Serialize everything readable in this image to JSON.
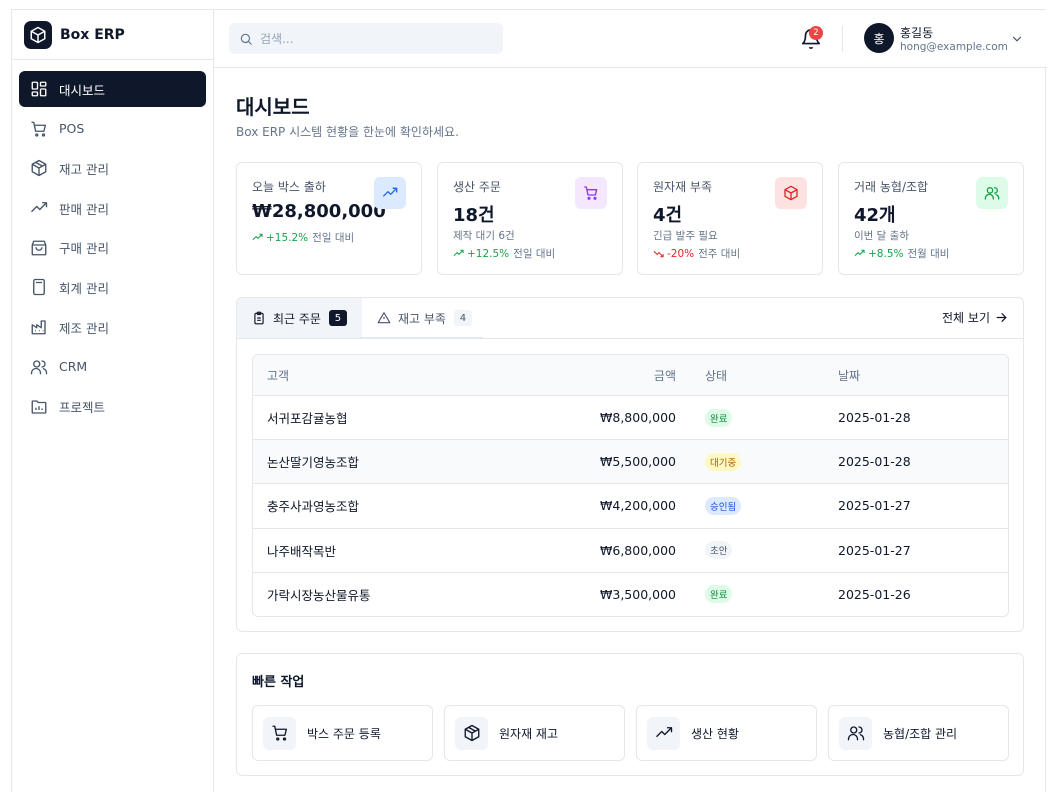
{
  "brand": {
    "name": "Box ERP"
  },
  "sidebar": {
    "items": [
      {
        "label": "대시보드",
        "icon": "dashboard-icon",
        "active": true
      },
      {
        "label": "POS",
        "icon": "cart-icon"
      },
      {
        "label": "재고 관리",
        "icon": "package-icon"
      },
      {
        "label": "판매 관리",
        "icon": "trending-up-icon"
      },
      {
        "label": "구매 관리",
        "icon": "shopping-bag-icon"
      },
      {
        "label": "회계 관리",
        "icon": "calculator-icon"
      },
      {
        "label": "제조 관리",
        "icon": "factory-icon"
      },
      {
        "label": "CRM",
        "icon": "users-icon"
      },
      {
        "label": "프로젝트",
        "icon": "folder-icon"
      }
    ]
  },
  "header": {
    "search_placeholder": "검색...",
    "notification_count": "2",
    "user": {
      "initial": "홍",
      "name": "홍길동",
      "email": "hong@example.com"
    }
  },
  "page": {
    "title": "대시보드",
    "subtitle": "Box ERP 시스템 현황을 한눈에 확인하세요."
  },
  "stats": [
    {
      "label": "오늘 박스 출하",
      "value": "₩28,800,000",
      "change": "+15.2%",
      "compare": "전일 대비",
      "icon": "trending-up-icon",
      "color": "#2563eb"
    },
    {
      "label": "생산 주문",
      "value": "18건",
      "note": "제작 대기 6건",
      "change": "+12.5%",
      "compare": "전일 대비",
      "icon": "cart-icon",
      "color": "#9333ea"
    },
    {
      "label": "원자재 부족",
      "value": "4건",
      "note": "긴급 발주 필요",
      "change": "-20%",
      "compare": "전주 대비",
      "icon": "package-icon",
      "color": "#dc2626"
    },
    {
      "label": "거래 농협/조합",
      "value": "42개",
      "note": "이번 달 출하",
      "change": "+8.5%",
      "compare": "전월 대비",
      "icon": "users-icon",
      "color": "#16a34a"
    }
  ],
  "orders": {
    "tabs": [
      {
        "label": "최근 주문",
        "count": "5"
      },
      {
        "label": "재고 부족",
        "count": "4"
      }
    ],
    "view_all": "전체 보기",
    "columns": {
      "customer": "고객",
      "amount": "금액",
      "status": "상태",
      "date": "날짜"
    },
    "rows": [
      {
        "customer": "서귀포감귤농협",
        "amount": "₩8,800,000",
        "status": "완료",
        "date": "2025-01-28"
      },
      {
        "customer": "논산딸기영농조합",
        "amount": "₩5,500,000",
        "status": "대기중",
        "date": "2025-01-28"
      },
      {
        "customer": "충주사과영농조합",
        "amount": "₩4,200,000",
        "status": "승인됨",
        "date": "2025-01-27"
      },
      {
        "customer": "나주배작목반",
        "amount": "₩6,800,000",
        "status": "초안",
        "date": "2025-01-27"
      },
      {
        "customer": "가락시장농산물유통",
        "amount": "₩3,500,000",
        "status": "완료",
        "date": "2025-01-26"
      }
    ]
  },
  "quick": {
    "title": "빠른 작업",
    "actions": [
      {
        "label": "박스 주문 등록",
        "icon": "cart-icon"
      },
      {
        "label": "원자재 재고",
        "icon": "package-icon"
      },
      {
        "label": "생산 현황",
        "icon": "trending-up-icon"
      },
      {
        "label": "농협/조합 관리",
        "icon": "users-icon"
      }
    ]
  }
}
